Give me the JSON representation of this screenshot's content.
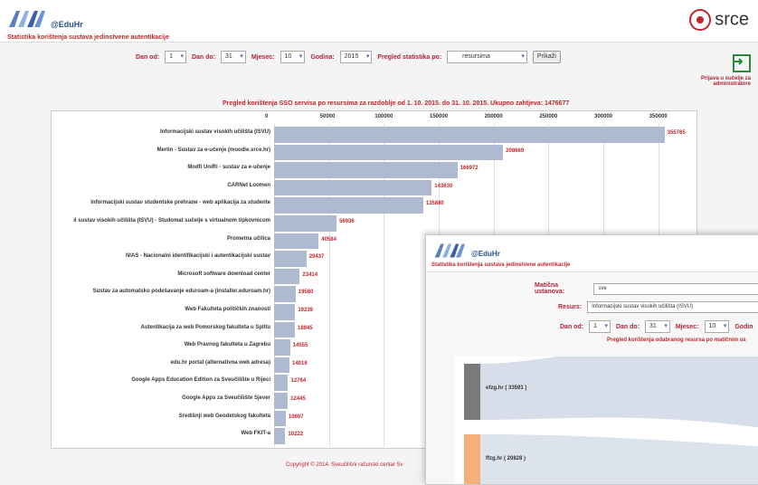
{
  "app": {
    "logo_text": "@EduHr",
    "subtitle": "Statistika korištenja sustava jedinstvene autentikacije",
    "brand": "srce"
  },
  "filters": {
    "dan_od_label": "Dan od:",
    "dan_od_value": "1",
    "dan_do_label": "Dan do:",
    "dan_do_value": "31",
    "mjesec_label": "Mjesec:",
    "mjesec_value": "10",
    "godina_label": "Godina:",
    "godina_value": "2015",
    "pregled_label": "Pregled statistika po:",
    "pregled_value": "resursima",
    "submit_label": "Prikaži"
  },
  "login": {
    "text": "Prijava u sučelje za administratore"
  },
  "chart_data": {
    "type": "bar",
    "orientation": "horizontal",
    "title": "Pregled korištenja SSO servisa po resursima za razdoblje od 1. 10. 2015. do 31. 10. 2015. Ukupno zahtjeva: 1476677",
    "xlim": [
      0,
      375000
    ],
    "ticks": [
      0,
      50000,
      100000,
      150000,
      200000,
      250000,
      300000,
      350000
    ],
    "categories": [
      "Informacijski sustav visokih učilišta (ISVU)",
      "Merlin - Sustav za e-učenje (moodle.srce.hr)",
      "Modfi UniRi - sustav za e-učenje",
      "CARNet Loomen",
      "Informacijski sustav studentske prehrane - web aplikacija za studente",
      "il sustav visokih učilišta (ISVU) - Studomat sučelje s virtualnom tipkovnicom",
      "Prometna učilica",
      "NIAS - Nacionalni identifikacijski i autentikacijski sustav",
      "Microsoft software download center",
      "Sustav za automatsko podešavanje eduroam-a (installer.eduroam.hr)",
      "Web Fakulteta političkih znanosti",
      "Autentikacija za web Pomorskog fakulteta u Splitu",
      "Web Pravnog fakulteta u Zagrebu",
      "edu.hr portal (alternativna web adresa)",
      "Google Apps Education Edition za Sveučilište u Rijeci",
      "Google Apps za Sveučilište Sjever",
      "Središnji web Geodetskog fakulteta",
      "Web FKIT-a"
    ],
    "values": [
      355765,
      208669,
      166972,
      143630,
      135880,
      56936,
      40584,
      29437,
      23414,
      19580,
      19239,
      18945,
      14555,
      14016,
      12764,
      12445,
      10607,
      10222
    ],
    "bar_color": "#adbad0",
    "value_color": "#c2262b"
  },
  "footer": {
    "text": "Copyright © 2014. Sveučilišni računski centar Sv"
  },
  "window2": {
    "logo_text": "@EduHr",
    "subtitle": "Statistika korištenja sustava jedinstvene autentikacije",
    "maticna_label": "Matična ustanova:",
    "maticna_value": "sve",
    "resurs_label": "Resurs:",
    "resurs_value": "Informacijski sustav visokih učilišta (ISVU)",
    "dan_od_label": "Dan od:",
    "dan_od_value": "1",
    "dan_do_label": "Dan do:",
    "dan_do_value": "31",
    "mjesec_label": "Mjesec:",
    "mjesec_value": "10",
    "godina_label": "Godin",
    "flow_title": "Pregled korištenja odabranog resursa po matičnim us",
    "nodes": [
      {
        "label": "efzg.hr ( 33591 )",
        "color": "#7a7a7a"
      },
      {
        "label": "ffzg.hr ( 20828 )",
        "color": "#f5b07a"
      }
    ]
  }
}
